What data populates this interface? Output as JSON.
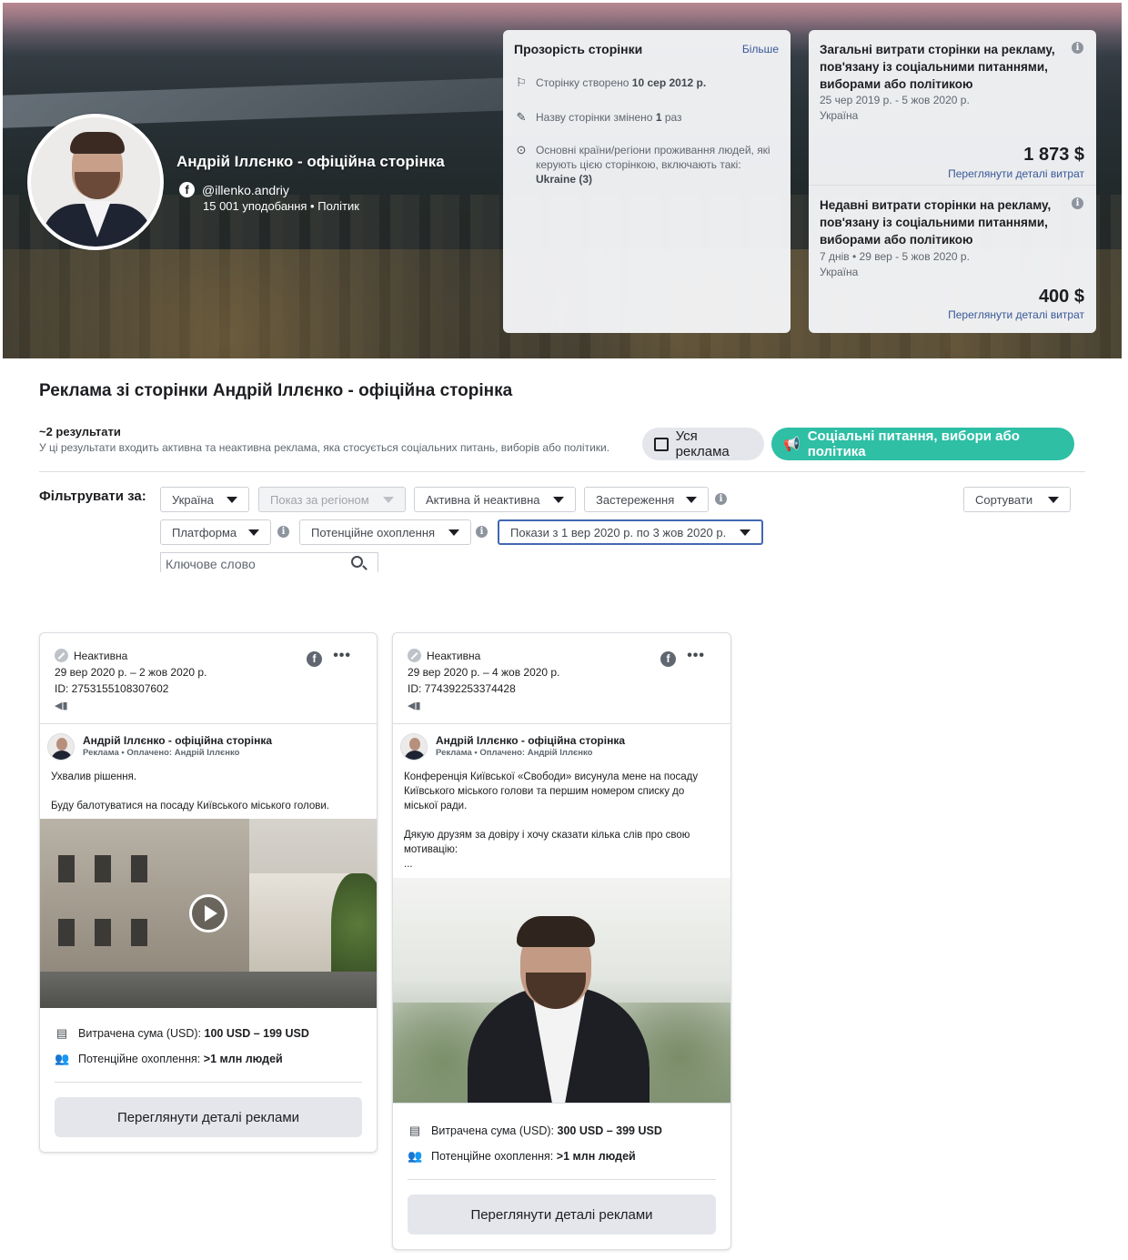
{
  "header": {
    "page_name": "Андрій Іллєнко - офіційна сторінка",
    "handle": "@illenko.andriy",
    "meta": "15 001 уподобання • Політик"
  },
  "transparency": {
    "title": "Прозорість сторінки",
    "more": "Більше",
    "created_label": "Сторінку створено",
    "created_value": "10 сер 2012 р.",
    "renamed_label": "Назву сторінки змінено",
    "renamed_count": "1",
    "renamed_suffix": "раз",
    "countries_text": "Основні країни/регіони проживання людей, які керують цією сторінкою, включають такі:",
    "countries_value": "Ukraine (3)"
  },
  "spend_total": {
    "title": "Загальні витрати сторінки на рекламу, пов'язану із соціальними питаннями, виборами або політикою",
    "dates": "25 чер 2019 р. - 5 жов 2020 р.",
    "country": "Україна",
    "amount": "1 873 $",
    "link": "Переглянути деталі витрат"
  },
  "spend_recent": {
    "title": "Недавні витрати сторінки на рекламу, пов'язану із соціальними питаннями, виборами або політикою",
    "dates": "7 днів • 29 вер - 5 жов 2020 р.",
    "country": "Україна",
    "amount": "400 $",
    "link": "Переглянути деталі витрат"
  },
  "main": {
    "title": "Реклама зі сторінки Андрій Іллєнко - офіційна сторінка",
    "results": "~2 результати",
    "results_note": "У ці результати входить активна та неактивна реклама, яка стосується соціальних питань, виборів або політики.",
    "pill_all": "Уся реклама",
    "pill_social": "Соціальні питання, вибори або політика"
  },
  "filters": {
    "label": "Фільтрувати за:",
    "country": "Україна",
    "region": "Показ за регіоном",
    "status": "Активна й неактивна",
    "disclaimer": "Застереження",
    "sort": "Сортувати",
    "platform": "Платформа",
    "reach": "Потенційне охоплення",
    "dates": "Покази з 1 вер 2020 р. по 3 жов 2020 р.",
    "keyword_placeholder": "Ключове слово"
  },
  "ads": [
    {
      "status": "Неактивна",
      "dates": "29 вер 2020 р. – 2 жов 2020 р.",
      "id": "ID: 2753155108307602",
      "page": "Андрій Іллєнко - офіційна сторінка",
      "sub": "Реклама • Оплачено: Андрій Іллєнко",
      "text_lines": [
        "Ухвалив рішення.",
        "",
        "Буду балотуватися на посаду Київського міського голови."
      ],
      "spent_label": "Витрачена сума (USD):",
      "spent_value": "100 USD – 199 USD",
      "reach_label": "Потенційне охоплення:",
      "reach_value": ">1 млн людей",
      "cta": "Переглянути деталі реклами"
    },
    {
      "status": "Неактивна",
      "dates": "29 вер 2020 р. – 4 жов 2020 р.",
      "id": "ID: 774392253374428",
      "page": "Андрій Іллєнко - офіційна сторінка",
      "sub": "Реклама • Оплачено: Андрій Іллєнко",
      "text_lines": [
        "Конференція Київської «Свободи» висунула мене на посаду Київського міського голови та першим номером списку до міської ради.",
        "",
        "Дякую друзям за довіру і хочу сказати кілька слів про свою мотивацію:",
        "..."
      ],
      "spent_label": "Витрачена сума (USD):",
      "spent_value": "300 USD – 399 USD",
      "reach_label": "Потенційне охоплення:",
      "reach_value": ">1 млн людей",
      "cta": "Переглянути деталі реклами"
    }
  ],
  "icons": {
    "facebook": "facebook-icon",
    "info": "info-icon",
    "caret": "caret-down-icon",
    "more": "more-icon",
    "megaphone": "megaphone-icon",
    "play": "play-icon",
    "coins": "coins-icon",
    "people": "people-icon",
    "search": "search-icon"
  },
  "colors": {
    "accent_teal": "#2ebfa5",
    "link_blue": "#385898",
    "pill_gray": "#e4e6eb"
  }
}
